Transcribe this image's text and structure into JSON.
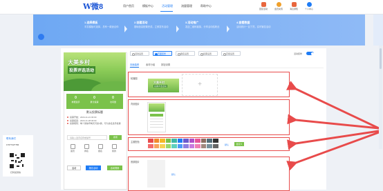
{
  "colors": {
    "brand": "#1e57d6",
    "accent": "#1f7cf5",
    "green": "#7bc24b",
    "highlight_red": "#e84b4b"
  },
  "logo": {
    "w": "W",
    "text": "微8"
  },
  "nav": {
    "items": [
      {
        "label": "用户首页"
      },
      {
        "label": "模板中心"
      },
      {
        "label": "活动管理"
      },
      {
        "label": "流量管理"
      },
      {
        "label": "帮助中心"
      }
    ],
    "active_index": 2
  },
  "tools": [
    {
      "label": "回复活动",
      "icon": "reply-icon"
    },
    {
      "label": "会员充值",
      "icon": "coin-icon"
    },
    {
      "label": "消息通知",
      "icon": "bell-icon"
    },
    {
      "label": "个人中心",
      "icon": "user-icon"
    }
  ],
  "steps": [
    {
      "title": "1.选择模板",
      "desc": "丰富模板可选择，总有一款适合你"
    },
    {
      "title": "2.创建活动",
      "desc": "基础信息配置完成，立即发布活动"
    },
    {
      "title": "3.活动推广",
      "desc": "发送二维码链接，分享活动给粉丝"
    },
    {
      "title": "4.查看数据",
      "desc": "活动统计一目了然，实时管控活动"
    }
  ],
  "preview": {
    "poster_title": "大美乡村",
    "poster_subtitle": "投票评选活动",
    "stats": [
      {
        "value": "0",
        "label": "参赛选手"
      },
      {
        "value": "0",
        "label": "累计投票"
      },
      {
        "value": "0",
        "label": "访问量"
      }
    ],
    "vote_title": "默认投票标题",
    "info": [
      "投票开始：2024-11-21 00:00",
      "投票结束：2024-11-28 00:00",
      "投票规则：每个微信号每天可投1票，可为多名选手投票"
    ],
    "search_placeholder": "请输入选手名称或编号",
    "search_button": "搜索",
    "tab_labels": [
      "首页",
      "排名",
      "报名",
      "我的"
    ],
    "bottom_buttons": [
      "活动",
      "报名活动",
      "活动规则"
    ]
  },
  "settings": {
    "top_chips": [
      "活动设置",
      "页面装修",
      "报名设置",
      "投票设置",
      "高级设置"
    ],
    "selected_chip": 1,
    "toggle_label": "活动装修",
    "subtabs": [
      "页面装修",
      "素材分组",
      "按钮设置"
    ],
    "sections": {
      "banner": {
        "label": "轮播图"
      },
      "background": {
        "label": "背景图片"
      },
      "theme": {
        "label": "主题配色",
        "custom_link": "默认",
        "custom_button": "自定义"
      },
      "footer": {
        "label": "底部图片",
        "link": "默认"
      }
    },
    "thumb_title": "大美乡村",
    "thumb_subtitle": "投票评选活动",
    "add_symbol": "+",
    "swatches": [
      "#e84b4b",
      "#f08a2c",
      "#f5b827",
      "#7bc24b",
      "#3fb8a6",
      "#1f7cf5",
      "#6a5acd",
      "#b14fc9",
      "#e5559a",
      "#8d6e63",
      "#546e7a",
      "#333333",
      "#f36c6c",
      "#f7a35c",
      "#f8d155",
      "#9ad66a",
      "#5fd0bf",
      "#4e9bf7",
      "#8e7fe0",
      "#c97be0",
      "#f07fb4",
      "#a1887f",
      "#78909c",
      "#666666"
    ]
  },
  "qr": {
    "title": "联系我们",
    "phone": "17677427784",
    "caption": "扫码加微信"
  }
}
